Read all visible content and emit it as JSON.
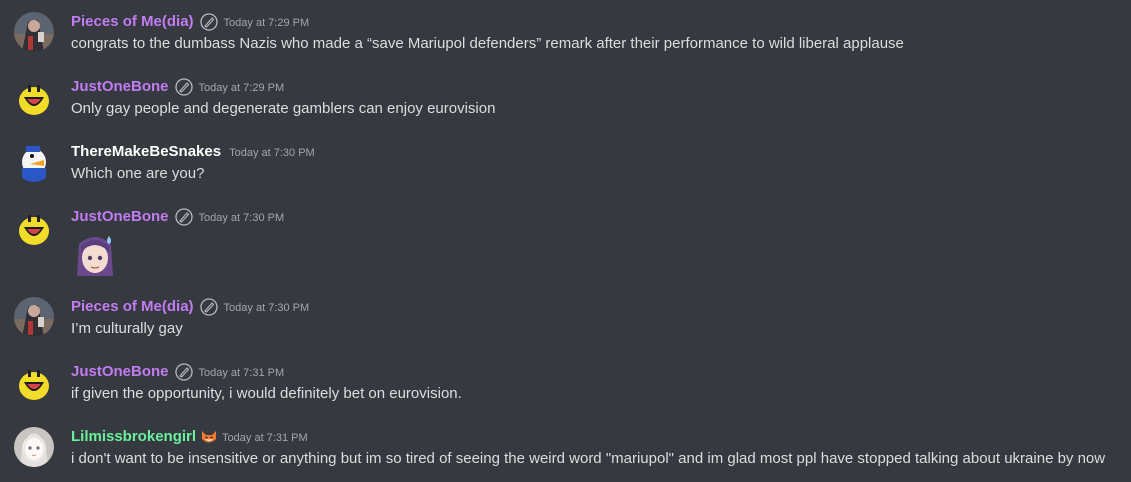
{
  "colors": {
    "background": "#36393f",
    "text": "#dcddde",
    "timestamp": "#a3a6aa",
    "purple_name": "#c17cf2",
    "white_name": "#ffffff",
    "green_name": "#6af09c"
  },
  "messages": [
    {
      "username": "Pieces of Me(dia)",
      "badge": "pen-badge-icon",
      "timestamp": "Today at 7:29 PM",
      "text": "congrats to the dumbass Nazis who made a “save Mariupol defenders” remark after their performance to wild liberal applause"
    },
    {
      "username": "JustOneBone",
      "badge": "pen-badge-icon",
      "timestamp": "Today at 7:29 PM",
      "text": "Only gay people and degenerate gamblers can enjoy eurovision"
    },
    {
      "username": "ThereMakeBeSnakes",
      "timestamp": "Today at 7:30 PM",
      "text": "Which one are you?"
    },
    {
      "username": "JustOneBone",
      "badge": "pen-badge-icon",
      "timestamp": "Today at 7:30 PM",
      "emoji": "anime-sweat-emoji"
    },
    {
      "username": "Pieces of Me(dia)",
      "badge": "pen-badge-icon",
      "timestamp": "Today at 7:30 PM",
      "text": "I’m culturally gay"
    },
    {
      "username": "JustOneBone",
      "badge": "pen-badge-icon",
      "timestamp": "Today at 7:31 PM",
      "text": "if given the opportunity, i would definitely bet on eurovision."
    },
    {
      "username": "Lilmissbrokengirl",
      "badge": "fox-badge-icon",
      "timestamp": "Today at 7:31 PM",
      "text": "i don't want to be insensitive or anything but im so tired of seeing the weird word \"mariupol\" and im glad most ppl have stopped talking about ukraine by now"
    }
  ]
}
